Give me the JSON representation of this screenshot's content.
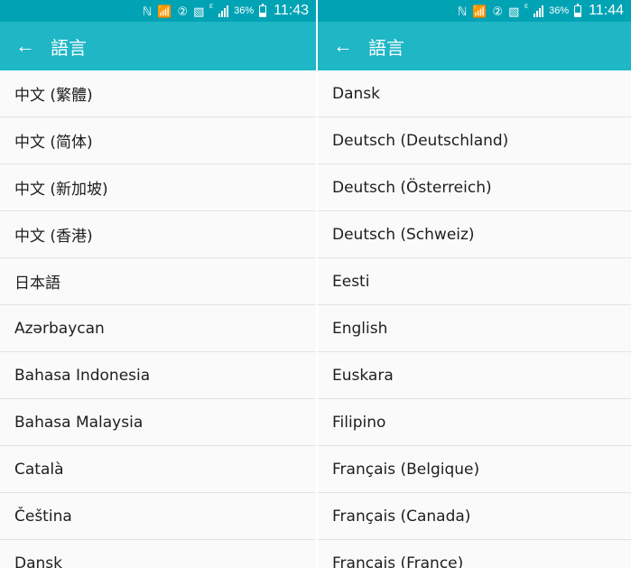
{
  "colors": {
    "statusbar": "#00a3b4",
    "appbar": "#1fb6c6",
    "text": "#1e1e1e",
    "background": "#fafafa"
  },
  "left": {
    "status": {
      "battery": "36%",
      "time": "11:43"
    },
    "title": "語言",
    "items": [
      "中文 (繁體)",
      "中文 (简体)",
      "中文 (新加坡)",
      "中文 (香港)",
      "日本語",
      "Azərbaycan",
      "Bahasa Indonesia",
      "Bahasa Malaysia",
      "Català",
      "Čeština",
      "Dansk"
    ]
  },
  "right": {
    "status": {
      "battery": "36%",
      "time": "11:44"
    },
    "title": "語言",
    "items": [
      "Dansk",
      "Deutsch (Deutschland)",
      "Deutsch (Österreich)",
      "Deutsch (Schweiz)",
      "Eesti",
      "English",
      "Euskara",
      "Filipino",
      "Français (Belgique)",
      "Français (Canada)",
      "Français (France)"
    ]
  }
}
